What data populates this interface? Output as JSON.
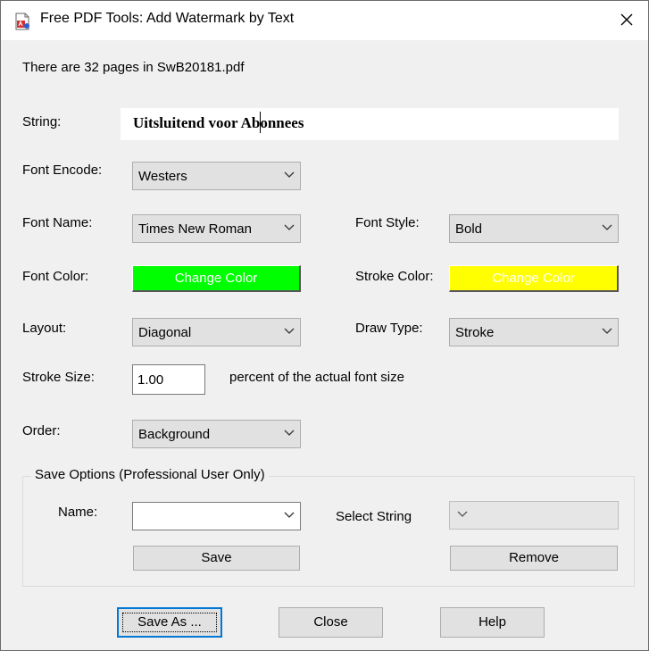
{
  "window": {
    "title": "Free PDF Tools: Add Watermark by Text",
    "close_symbol": "✕"
  },
  "info": {
    "pages_text": "There are 32 pages in SwB20181.pdf"
  },
  "string": {
    "label": "String:",
    "value": "Uitsluitend voor Abonnees"
  },
  "font_encode": {
    "label": "Font Encode:",
    "value": "Westers"
  },
  "font_name": {
    "label": "Font Name:",
    "value": "Times New Roman"
  },
  "font_style": {
    "label": "Font Style:",
    "value": "Bold"
  },
  "font_color": {
    "label": "Font Color:",
    "button": "Change Color",
    "color": "#00ff00"
  },
  "stroke_color": {
    "label": "Stroke Color:",
    "button": "Change Color",
    "color": "#ffff00"
  },
  "layout": {
    "label": "Layout:",
    "value": "Diagonal"
  },
  "draw_type": {
    "label": "Draw Type:",
    "value": "Stroke"
  },
  "stroke_size": {
    "label": "Stroke Size:",
    "value": "1.00",
    "suffix": "percent of the actual font size"
  },
  "order": {
    "label": "Order:",
    "value": "Background"
  },
  "save_options": {
    "title": "Save Options (Professional User Only)",
    "name_label": "Name:",
    "name_value": "",
    "select_string_label": "Select String",
    "save_button": "Save",
    "remove_button": "Remove"
  },
  "footer": {
    "save_as": "Save As ...",
    "close": "Close",
    "help": "Help"
  },
  "icons": {
    "app": "pdf-file-icon",
    "chevron": "chevron-down-icon"
  }
}
